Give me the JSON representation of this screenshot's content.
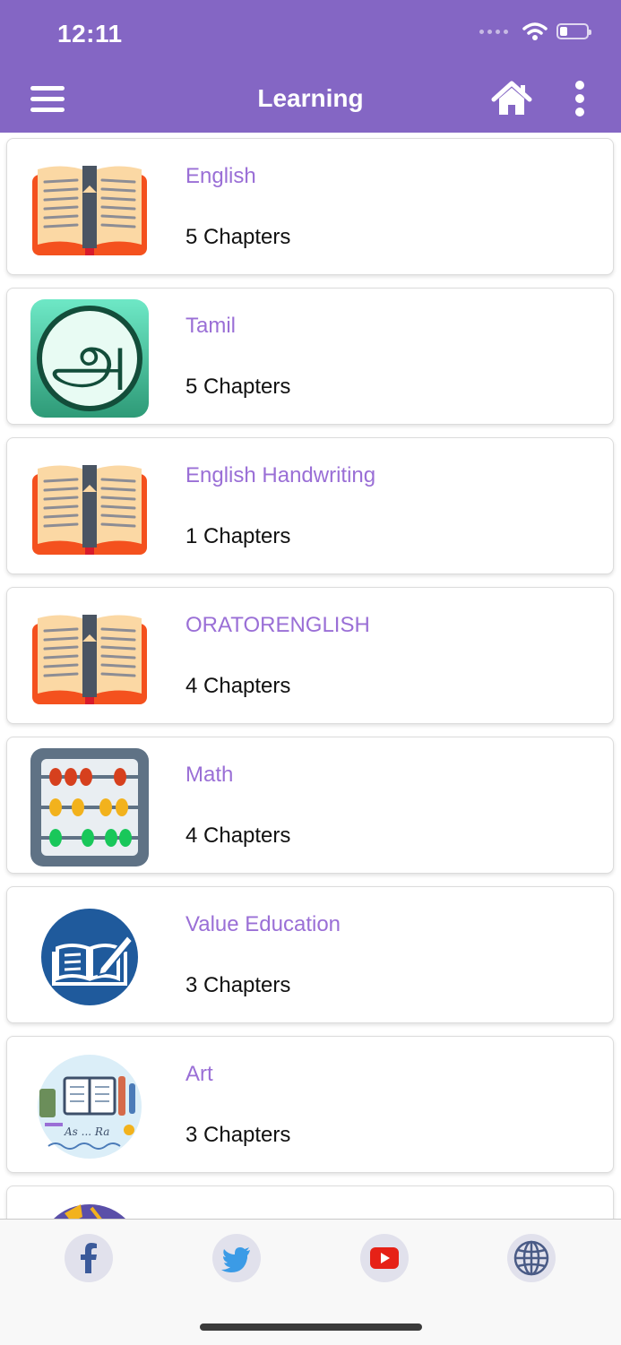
{
  "status": {
    "time": "12:11"
  },
  "app_bar": {
    "title": "Learning"
  },
  "subjects": [
    {
      "title": "English",
      "chapters": "5 Chapters",
      "icon": "open-book-icon"
    },
    {
      "title": "Tamil",
      "chapters": "5 Chapters",
      "icon": "tamil-letter-icon"
    },
    {
      "title": "English Handwriting",
      "chapters": "1 Chapters",
      "icon": "open-book-icon"
    },
    {
      "title": "ORATORENGLISH",
      "chapters": "4 Chapters",
      "icon": "open-book-icon"
    },
    {
      "title": "Math",
      "chapters": "4 Chapters",
      "icon": "abacus-icon"
    },
    {
      "title": "Value Education",
      "chapters": "3 Chapters",
      "icon": "book-pen-icon"
    },
    {
      "title": "Art",
      "chapters": "3 Chapters",
      "icon": "art-supplies-icon"
    }
  ],
  "footer": {
    "social": [
      "facebook-icon",
      "twitter-icon",
      "youtube-icon",
      "globe-icon"
    ]
  },
  "colors": {
    "header": "#8466c4",
    "subject_title": "#9a6fd6",
    "book_cover": "#f4511e",
    "book_pages": "#fbd8a4"
  }
}
